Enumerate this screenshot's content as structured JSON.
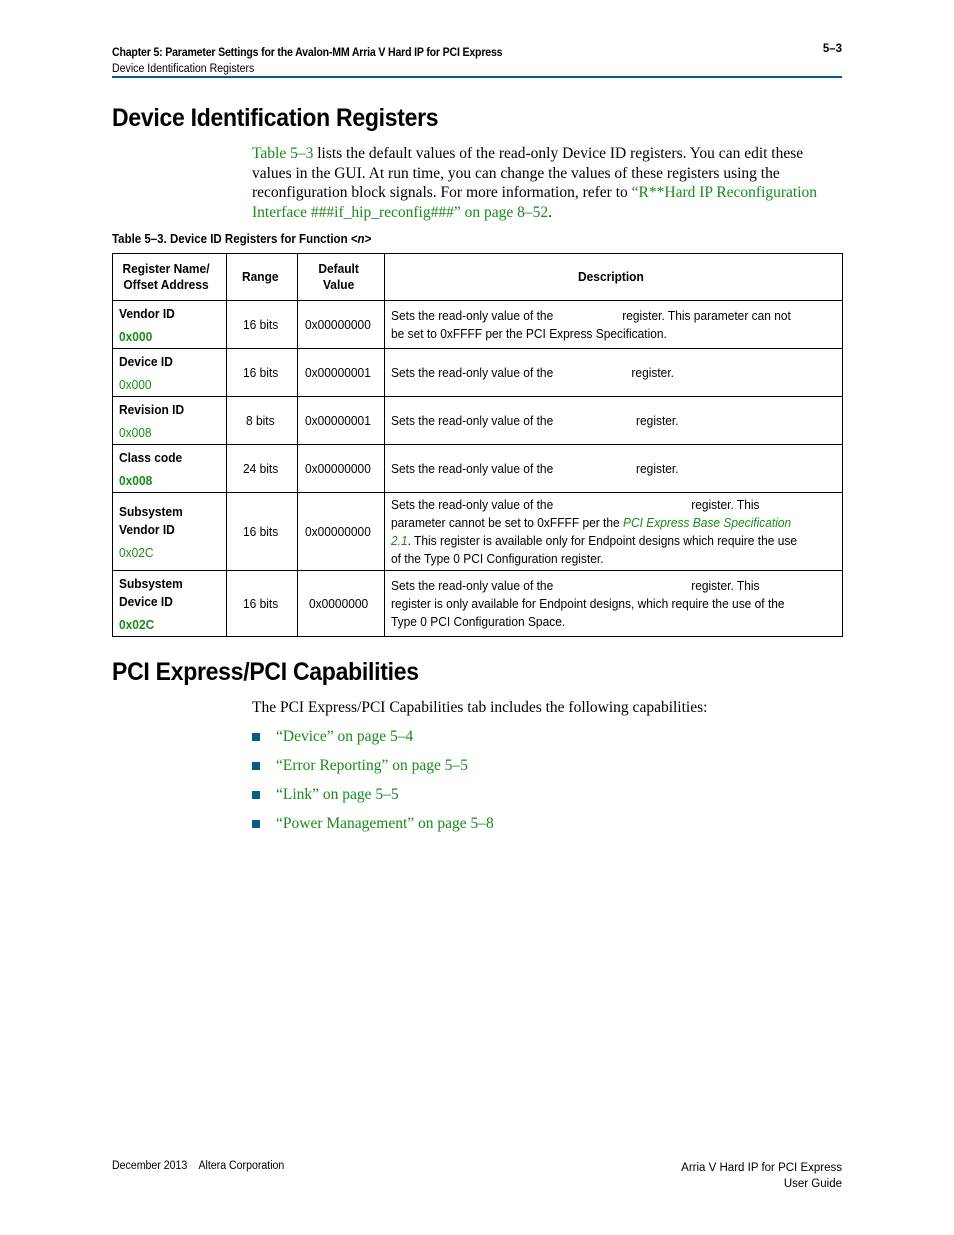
{
  "header": {
    "chapter_title": "Chapter 5:  Parameter Settings for the Avalon-MM Arria V Hard IP for PCI Express",
    "page_number": "5–3",
    "section": "Device Identification Registers"
  },
  "section1": {
    "title": "Device Identification Registers",
    "intro": {
      "link1": "Table 5–3",
      "text1": " lists the default values of the read-only Device ID registers. You can edit these values in the GUI. At run time, you can change the values of these registers using the reconfiguration block signals. For more information, refer to ",
      "link2": "“R**Hard IP Reconfiguration Interface ###if_hip_reconfig###” on page 8–52",
      "text2": "."
    },
    "table_caption": "Table 5–3.  Device ID Registers for Function <n>",
    "table": {
      "headers": [
        "Register Name/ Offset Address",
        "Range",
        "Default Value",
        "Description"
      ],
      "rows": [
        {
          "name": "Vendor ID",
          "offset": "0x000",
          "offset_bold": true,
          "range": "16 bits",
          "default": "0x00000000",
          "desc_a": "Sets the read-only value of the",
          "desc_b": "register. This parameter can not be set to 0xFFFF per the PCI Express Specification.",
          "desc_link": "",
          "desc_c": ""
        },
        {
          "name": "Device ID",
          "offset": "0x000",
          "offset_bold": false,
          "range": "16 bits",
          "default": "0x00000001",
          "desc_a": "Sets the read-only value of the",
          "desc_b": "register.",
          "desc_link": "",
          "desc_c": ""
        },
        {
          "name": "Revision ID",
          "offset": "0x008",
          "offset_bold": false,
          "range": "8 bits",
          "default": "0x00000001",
          "desc_a": "Sets the read-only value of the",
          "desc_b": "register.",
          "desc_link": "",
          "desc_c": ""
        },
        {
          "name": "Class code",
          "offset": "0x008",
          "offset_bold": true,
          "range": "24 bits",
          "default": "0x00000000",
          "desc_a": "Sets the read-only value of the",
          "desc_b": "register.",
          "desc_link": "",
          "desc_c": ""
        },
        {
          "name": "Subsystem Vendor ID",
          "offset": "0x02C",
          "offset_bold": false,
          "range": "16 bits",
          "default": "0x00000000",
          "desc_a": "Sets the read-only value of the",
          "desc_b": "register. This parameter cannot be set to 0xFFFF per the ",
          "desc_link": "PCI Express Base Specification 2.1",
          "desc_c": ". This register is available only for Endpoint designs which require the use of the Type 0 PCI Configuration register."
        },
        {
          "name": "Subsystem Device ID",
          "offset": "0x02C",
          "offset_bold": true,
          "range": "16 bits",
          "default": "0x0000000",
          "desc_a": "Sets the read-only value of the",
          "desc_b": "register. This register is only available for Endpoint designs, which require the use of the Type 0 PCI Configuration Space.",
          "desc_link": "",
          "desc_c": ""
        }
      ]
    }
  },
  "section2": {
    "title": "PCI Express/PCI Capabilities",
    "intro": "The PCI Express/PCI Capabilities tab includes the following capabilities:",
    "items": [
      "“Device” on page 5–4",
      "“Error Reporting” on page 5–5",
      "“Link” on page 5–5",
      "“Power Management” on page 5–8"
    ]
  },
  "footer": {
    "left": "December 2013    Altera Corporation",
    "right_line1": "Arria V Hard IP for PCI Express",
    "right_line2": "User Guide"
  },
  "colors": {
    "link": "#1a8a1a",
    "rule": "#0a5a8c"
  }
}
